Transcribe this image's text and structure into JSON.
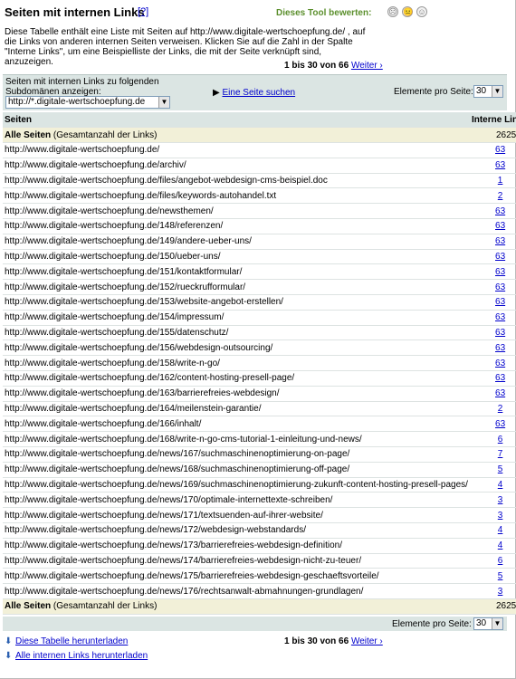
{
  "header": {
    "title": "Seiten mit internen Links",
    "help": "[?]",
    "rate_label": "Dieses Tool bewerten:",
    "rate_icons": [
      "☹",
      "😐",
      "☺"
    ]
  },
  "description": "Diese Tabelle enthält eine Liste mit Seiten auf http://www.digitale-wertschoepfung.de/ , auf die Links von anderen internen Seiten verweisen. Klicken Sie auf die Zahl in der Spalte \"Interne Links\", um eine Beispielliste der Links, die mit der Seite verknüpft sind, anzuzeigen.",
  "pager": {
    "range": "1 bis 30 von 66",
    "next": "Weiter ›"
  },
  "filter": {
    "label": "Seiten mit internen Links zu folgenden Subdomänen anzeigen:",
    "subdomain": "http://*.digitale-wertschoepfung.de",
    "search_link": "Eine Seite suchen",
    "per_page_label": "Elemente pro Seite:",
    "per_page_value": "30"
  },
  "table": {
    "col_pages": "Seiten",
    "col_links": "Interne Links",
    "total_label_bold": "Alle Seiten",
    "total_label_rest": " (Gesamtanzahl der Links)",
    "total_value": "2625",
    "rows": [
      {
        "url": "http://www.digitale-wertschoepfung.de/",
        "links": "63"
      },
      {
        "url": "http://www.digitale-wertschoepfung.de/archiv/",
        "links": "63"
      },
      {
        "url": "http://www.digitale-wertschoepfung.de/files/angebot-webdesign-cms-beispiel.doc",
        "links": "1"
      },
      {
        "url": "http://www.digitale-wertschoepfung.de/files/keywords-autohandel.txt",
        "links": "2"
      },
      {
        "url": "http://www.digitale-wertschoepfung.de/newsthemen/",
        "links": "63"
      },
      {
        "url": "http://www.digitale-wertschoepfung.de/148/referenzen/",
        "links": "63"
      },
      {
        "url": "http://www.digitale-wertschoepfung.de/149/andere-ueber-uns/",
        "links": "63"
      },
      {
        "url": "http://www.digitale-wertschoepfung.de/150/ueber-uns/",
        "links": "63"
      },
      {
        "url": "http://www.digitale-wertschoepfung.de/151/kontaktformular/",
        "links": "63"
      },
      {
        "url": "http://www.digitale-wertschoepfung.de/152/rueckrufformular/",
        "links": "63"
      },
      {
        "url": "http://www.digitale-wertschoepfung.de/153/website-angebot-erstellen/",
        "links": "63"
      },
      {
        "url": "http://www.digitale-wertschoepfung.de/154/impressum/",
        "links": "63"
      },
      {
        "url": "http://www.digitale-wertschoepfung.de/155/datenschutz/",
        "links": "63"
      },
      {
        "url": "http://www.digitale-wertschoepfung.de/156/webdesign-outsourcing/",
        "links": "63"
      },
      {
        "url": "http://www.digitale-wertschoepfung.de/158/write-n-go/",
        "links": "63"
      },
      {
        "url": "http://www.digitale-wertschoepfung.de/162/content-hosting-presell-page/",
        "links": "63"
      },
      {
        "url": "http://www.digitale-wertschoepfung.de/163/barrierefreies-webdesign/",
        "links": "63"
      },
      {
        "url": "http://www.digitale-wertschoepfung.de/164/meilenstein-garantie/",
        "links": "2"
      },
      {
        "url": "http://www.digitale-wertschoepfung.de/166/inhalt/",
        "links": "63"
      },
      {
        "url": "http://www.digitale-wertschoepfung.de/168/write-n-go-cms-tutorial-1-einleitung-und-news/",
        "links": "6"
      },
      {
        "url": "http://www.digitale-wertschoepfung.de/news/167/suchmaschinenoptimierung-on-page/",
        "links": "7"
      },
      {
        "url": "http://www.digitale-wertschoepfung.de/news/168/suchmaschinenoptimierung-off-page/",
        "links": "5"
      },
      {
        "url": "http://www.digitale-wertschoepfung.de/news/169/suchmaschinenoptimierung-zukunft-content-hosting-presell-pages/",
        "links": "4"
      },
      {
        "url": "http://www.digitale-wertschoepfung.de/news/170/optimale-internettexte-schreiben/",
        "links": "3"
      },
      {
        "url": "http://www.digitale-wertschoepfung.de/news/171/textsuenden-auf-ihrer-website/",
        "links": "3"
      },
      {
        "url": "http://www.digitale-wertschoepfung.de/news/172/webdesign-webstandards/",
        "links": "4"
      },
      {
        "url": "http://www.digitale-wertschoepfung.de/news/173/barrierefreies-webdesign-definition/",
        "links": "4"
      },
      {
        "url": "http://www.digitale-wertschoepfung.de/news/174/barrierefreies-webdesign-nicht-zu-teuer/",
        "links": "6"
      },
      {
        "url": "http://www.digitale-wertschoepfung.de/news/175/barrierefreies-webdesign-geschaeftsvorteile/",
        "links": "5"
      },
      {
        "url": "http://www.digitale-wertschoepfung.de/news/176/rechtsanwalt-abmahnungen-grundlagen/",
        "links": "3"
      }
    ]
  },
  "downloads": {
    "table": "Diese Tabelle herunterladen",
    "all": "Alle internen Links herunterladen"
  },
  "colors": {
    "bar": "#dbe5e3",
    "total_row": "#f2f0d8",
    "link": "#0000cc",
    "rate": "#5b8f2c"
  }
}
